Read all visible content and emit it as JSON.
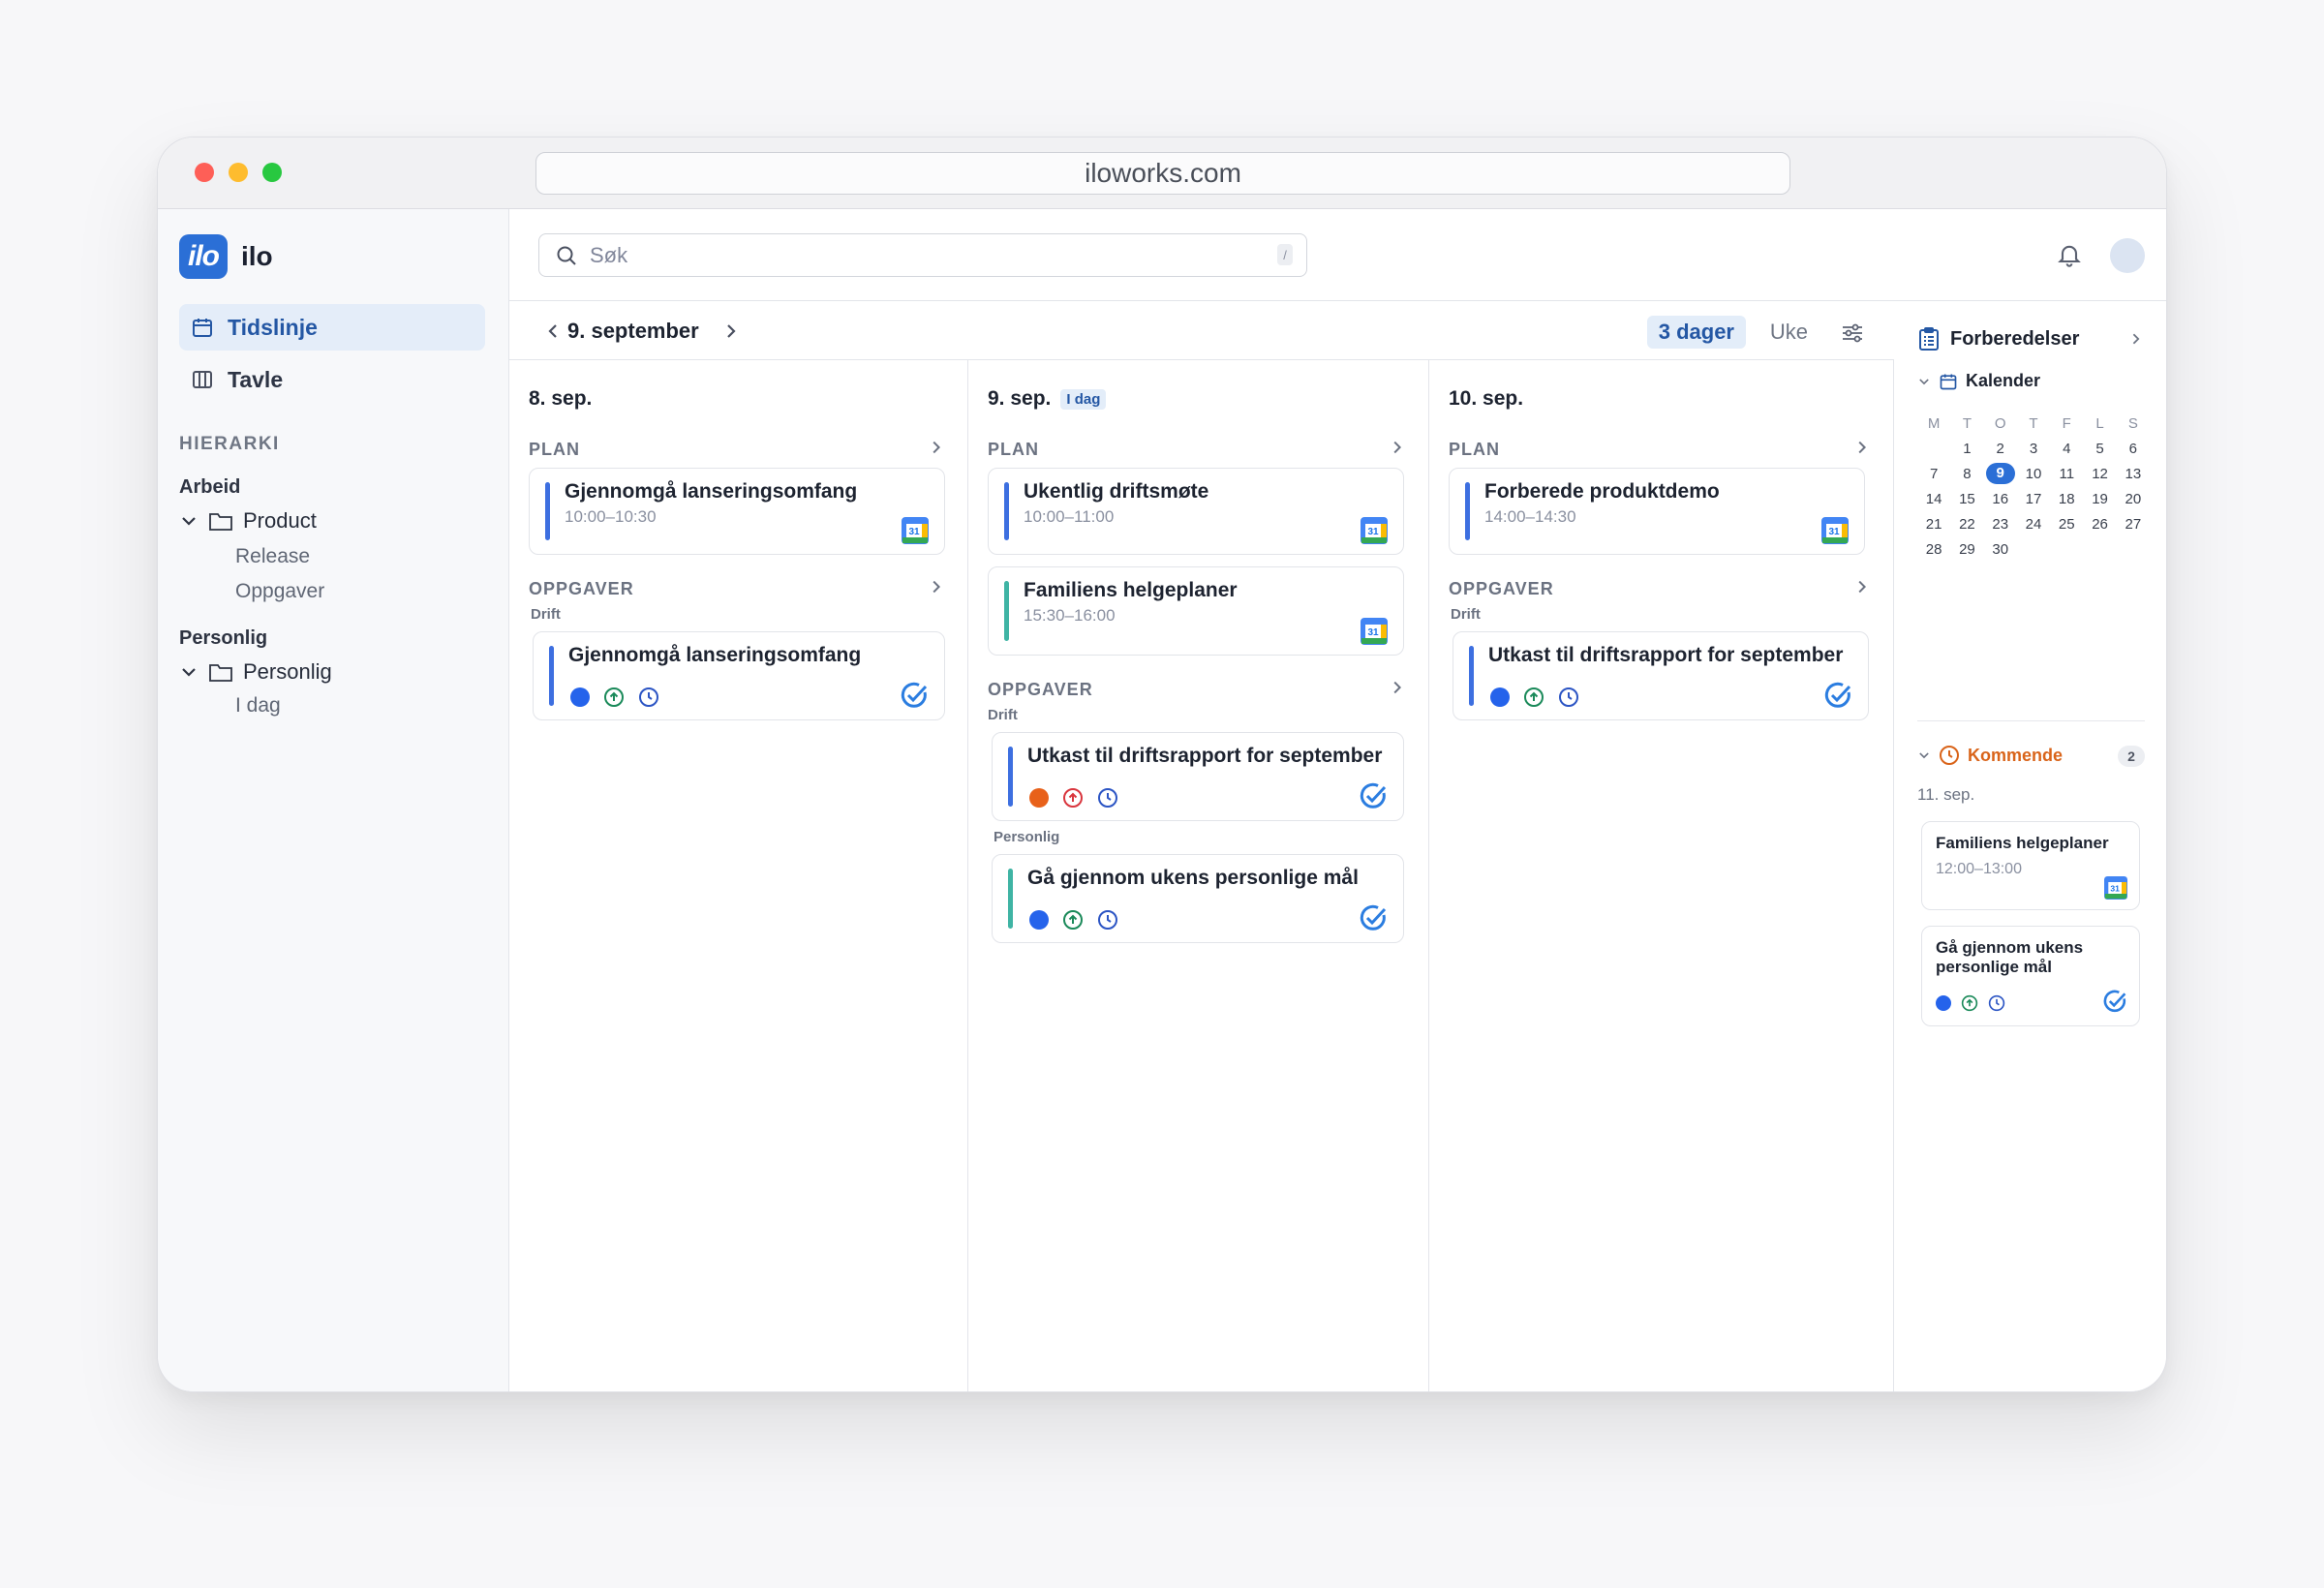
{
  "browser": {
    "url": "iloworks.com"
  },
  "app": {
    "name": "ilo",
    "logo_text": "ilo"
  },
  "sidebar": {
    "nav": [
      {
        "label": "Tidslinje",
        "active": true
      },
      {
        "label": "Tavle",
        "active": false
      }
    ],
    "hierarchy_title": "HIERARKI",
    "groups": [
      {
        "title": "Arbeid",
        "folder": "Product",
        "children": [
          "Release",
          "Oppgaver"
        ]
      },
      {
        "title": "Personlig",
        "folder": "Personlig",
        "children": [
          "I dag"
        ]
      }
    ]
  },
  "topbar": {
    "search_placeholder": "Søk",
    "search_shortcut": "/"
  },
  "toolbar": {
    "current_date": "9. september",
    "view_active": "3 dager",
    "view_other": "Uke"
  },
  "columns": [
    {
      "date": "8. sep.",
      "today_badge": "",
      "plan_label": "PLAN",
      "plan": [
        {
          "title": "Gjennomgå lanseringsomfang",
          "time": "10:00–10:30",
          "bar": "#3d6fe0"
        }
      ],
      "tasks_label": "OPPGAVER",
      "task_groups": [
        {
          "name": "Drift",
          "tasks": [
            {
              "title": "Gjennomgå lanseringsomfang",
              "bar": "#3d6fe0",
              "status": "#2563eb",
              "priority": "#1b8a5a"
            }
          ]
        }
      ]
    },
    {
      "date": "9. sep.",
      "today_badge": "I dag",
      "plan_label": "PLAN",
      "plan": [
        {
          "title": "Ukentlig driftsmøte",
          "time": "10:00–11:00",
          "bar": "#3d6fe0"
        },
        {
          "title": "Familiens helgeplaner",
          "time": "15:30–16:00",
          "bar": "#3fb4a4"
        }
      ],
      "tasks_label": "OPPGAVER",
      "task_groups": [
        {
          "name": "Drift",
          "tasks": [
            {
              "title": "Utkast til driftsrapport for september",
              "bar": "#3d6fe0",
              "status": "#e8611a",
              "priority": "#d9363e"
            }
          ]
        },
        {
          "name": "Personlig",
          "tasks": [
            {
              "title": "Gå gjennom ukens personlige mål",
              "bar": "#3fb4a4",
              "status": "#2563eb",
              "priority": "#1b8a5a"
            }
          ]
        }
      ]
    },
    {
      "date": "10. sep.",
      "today_badge": "",
      "plan_label": "PLAN",
      "plan": [
        {
          "title": "Forberede produktdemo",
          "time": "14:00–14:30",
          "bar": "#3d6fe0"
        }
      ],
      "tasks_label": "OPPGAVER",
      "task_groups": [
        {
          "name": "Drift",
          "tasks": [
            {
              "title": "Utkast til driftsrapport for september",
              "bar": "#3d6fe0",
              "status": "#2563eb",
              "priority": "#1b8a5a"
            }
          ]
        }
      ]
    }
  ],
  "right_panel": {
    "title": "Forberedelser",
    "calendar_label": "Kalender",
    "weekdays": [
      "M",
      "T",
      "O",
      "T",
      "F",
      "L",
      "S"
    ],
    "weeks": [
      [
        "",
        "1",
        "2",
        "3",
        "4",
        "5",
        "6"
      ],
      [
        "7",
        "8",
        "9",
        "10",
        "11",
        "12",
        "13"
      ],
      [
        "14",
        "15",
        "16",
        "17",
        "18",
        "19",
        "20"
      ],
      [
        "21",
        "22",
        "23",
        "24",
        "25",
        "26",
        "27"
      ],
      [
        "28",
        "29",
        "30",
        "",
        "",
        "",
        ""
      ]
    ],
    "today": "9",
    "upcoming_label": "Kommende",
    "upcoming_count": "2",
    "upcoming_date": "11. sep.",
    "upcoming_items": [
      {
        "title": "Familiens helgeplaner",
        "time": "12:00–13:00"
      },
      {
        "title": "Gå gjennom ukens personlige mål",
        "time": ""
      }
    ]
  },
  "colors": {
    "accent": "#2b6fd6",
    "today_bg": "#e3edf9",
    "upcoming": "#d9641a"
  }
}
